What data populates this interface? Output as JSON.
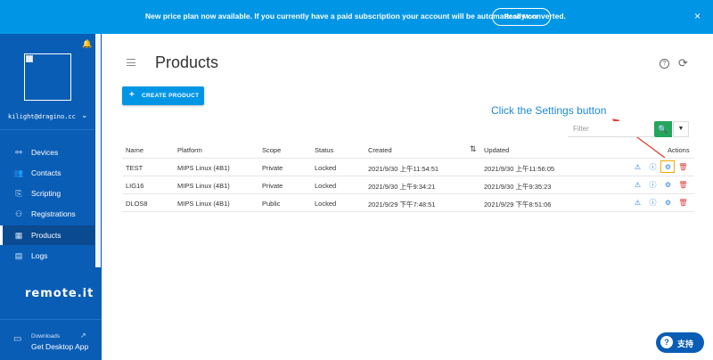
{
  "banner": {
    "message": "New price plan now available. If you currently have a paid subscription your account will be automatically converted.",
    "read_more": "Read More",
    "close": "×"
  },
  "user": {
    "email": "kilight@dragino.cc"
  },
  "sidebar": {
    "items": [
      {
        "label": "Devices",
        "icon": "devices-icon",
        "glyph": "⚯"
      },
      {
        "label": "Contacts",
        "icon": "contacts-icon",
        "glyph": "👥"
      },
      {
        "label": "Scripting",
        "icon": "scripting-icon",
        "glyph": "⎘"
      },
      {
        "label": "Registrations",
        "icon": "registrations-icon",
        "glyph": "⚇"
      },
      {
        "label": "Products",
        "icon": "products-icon",
        "glyph": "▦",
        "active": true
      },
      {
        "label": "Logs",
        "icon": "logs-icon",
        "glyph": "▤"
      }
    ],
    "logo": "remote.it",
    "download_small": "Downloads",
    "download_big": "Get Desktop App"
  },
  "page": {
    "title": "Products"
  },
  "toolbar": {
    "create_label": "CREATE PRODUCT"
  },
  "annotation": "Click the Settings button",
  "filter": {
    "placeholder": "Filter"
  },
  "table": {
    "headers": {
      "name": "Name",
      "platform": "Platform",
      "scope": "Scope",
      "status": "Status",
      "created": "Created",
      "updated": "Updated",
      "actions": "Actions"
    },
    "rows": [
      {
        "name": "TEST",
        "platform": "MIPS Linux (4B1)",
        "scope": "Private",
        "status": "Locked",
        "created": "2021/9/30 上午11:54:51",
        "updated": "2021/9/30 上午11:56:05"
      },
      {
        "name": "LIG16",
        "platform": "MIPS Linux (4B1)",
        "scope": "Private",
        "status": "Locked",
        "created": "2021/9/30 上午9:34:21",
        "updated": "2021/9/30 上午9:35:23"
      },
      {
        "name": "DLOS8",
        "platform": "MIPS Linux (4B1)",
        "scope": "Public",
        "status": "Locked",
        "created": "2021/9/29 下午7:48:51",
        "updated": "2021/9/29 下午8:51:06"
      }
    ]
  },
  "support": {
    "label": "支持"
  },
  "colors": {
    "primary": "#0096e5",
    "sidebar": "#0a5db5",
    "success": "#22a65a",
    "danger": "#e04343",
    "highlight": "#f2a900"
  }
}
